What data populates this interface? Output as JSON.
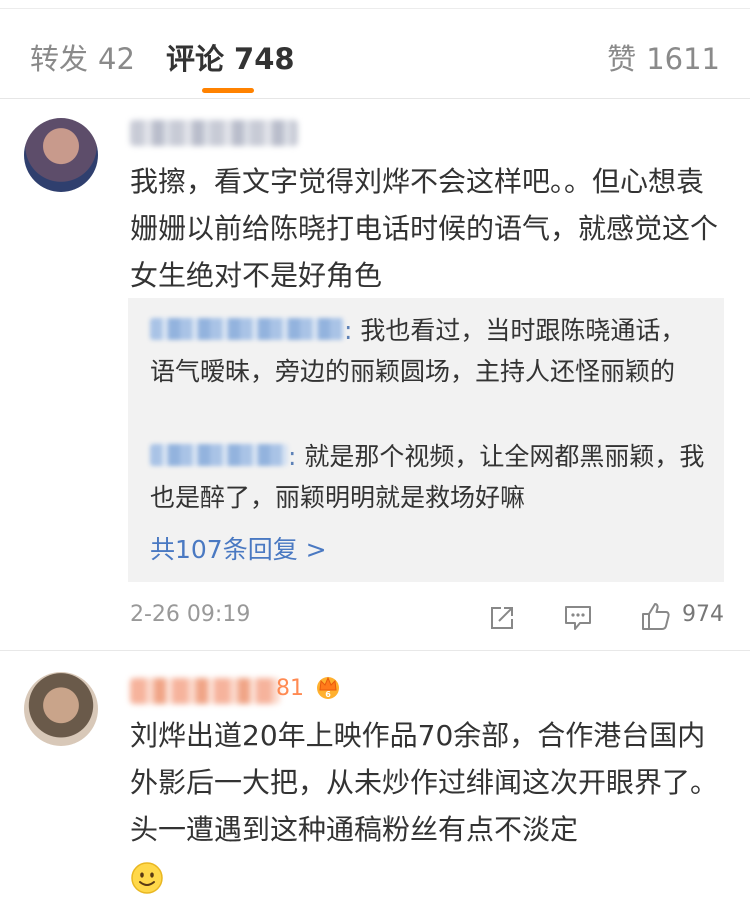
{
  "tabs": {
    "repost_label": "转发",
    "repost_count": "42",
    "comment_label": "评论",
    "comment_count": "748",
    "like_label": "赞",
    "like_count": "1611"
  },
  "comments": [
    {
      "text": "我擦，看文字觉得刘烨不会这样吧。。但心想袁姗姗以前给陈晓打电话时候的语气，就感觉这个女生绝对不是好角色",
      "replies": [
        {
          "text": "我也看过，当时跟陈晓通话，语气暧昧，旁边的丽颖圆场，主持人还怪丽颖的"
        },
        {
          "text": "就是那个视频，让全网都黑丽颖，我也是醉了，丽颖明明就是救场好嘛"
        }
      ],
      "more_replies": "共107条回复 >",
      "time": "2-26 09:19",
      "likes": "974"
    },
    {
      "name_tail": "81",
      "text": "刘烨出道20年上映作品70余部，合作港台国内外影后一大把，从未炒作过绯闻这次开眼界了。头一遭遇到这种通稿粉丝有点不淡定"
    }
  ],
  "colors": {
    "accent": "#ff8200",
    "link": "#4a79c2",
    "reply_bg": "#f2f2f2"
  }
}
